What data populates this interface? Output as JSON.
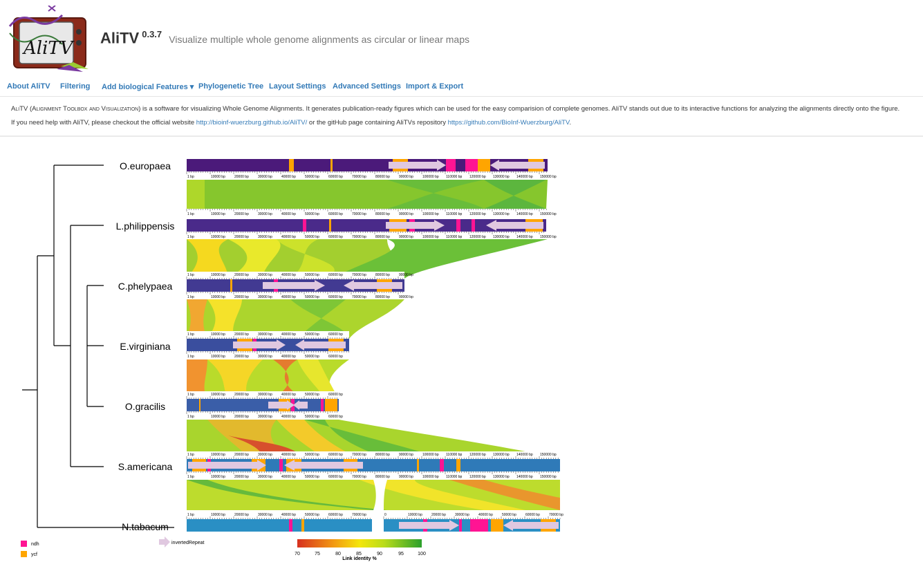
{
  "app": {
    "name": "AliTV",
    "version": "0.3.7",
    "subtitle": "Visualize multiple whole genome alignments as circular or linear maps",
    "logo_text": "AliTV"
  },
  "nav": {
    "items": [
      {
        "label": "About AliTV"
      },
      {
        "label": "Filtering"
      },
      {
        "label": "Add biological Features"
      },
      {
        "label": "Phylogenetic Tree"
      },
      {
        "label": "Layout Settings"
      },
      {
        "label": "Advanced Settings"
      },
      {
        "label": "Import & Export"
      }
    ],
    "dropdown_caret": "▾"
  },
  "info": {
    "name_short": "AliTV",
    "name_long": "(Alignment Toolbox and Visualization)",
    "description": "is a software for visualizing Whole Genome Alignments. It generates publication-ready figures which can be used for the easy comparision of complete genomes. AliTV stands out due to its interactive functions for analyzing the alignments directly onto the figure.",
    "help_prefix": "If you need help with AliTV, please checkout the official website",
    "website": "http://bioinf-wuerzburg.github.io/AliTV/",
    "help_middle": "or the gitHub page containing AliTVs repository",
    "repo": "https://github.com/BioInf-Wuerzburg/AliTV",
    "help_suffix": "."
  },
  "colors": {
    "ndh": "#ff1493",
    "ycf": "#ffa500",
    "inverted_repeat": "#e0c8e0",
    "link_low": "#d7301f",
    "link_high": "#2ca02c"
  },
  "genomes": [
    {
      "name": "O.europaea",
      "color": "#4b1a7a",
      "ticks": [
        "1 bp",
        "10000 bp",
        "20000 bp",
        "30000 bp",
        "40000 bp",
        "50000 bp",
        "60000 bp",
        "70000 bp",
        "80000 bp",
        "90000 bp",
        "100000 bp",
        "110000 bp",
        "120000 bp",
        "130000 bp",
        "140000 bp",
        "150000 bp"
      ]
    },
    {
      "name": "L.philippensis",
      "color": "#4a2a8a",
      "ticks": [
        "1 bp",
        "10000 bp",
        "20000 bp",
        "30000 bp",
        "40000 bp",
        "50000 bp",
        "60000 bp",
        "70000 bp",
        "80000 bp",
        "90000 bp",
        "100000 bp",
        "110000 bp",
        "120000 bp",
        "130000 bp",
        "140000 bp",
        "150000 bp"
      ]
    },
    {
      "name": "C.phelypaea",
      "color": "#423a92",
      "ticks": [
        "1 bp",
        "10000 bp",
        "20000 bp",
        "30000 bp",
        "40000 bp",
        "50000 bp",
        "60000 bp",
        "70000 bp",
        "80000 bp",
        "90000 bp"
      ]
    },
    {
      "name": "E.virginiana",
      "color": "#3a4e9e",
      "ticks": [
        "1 bp",
        "10000 bp",
        "20000 bp",
        "30000 bp",
        "40000 bp",
        "50000 bp",
        "60000 bp",
        "70000 bp"
      ]
    },
    {
      "name": "O.gracilis",
      "color": "#3a5ea8",
      "ticks": [
        "1 bp",
        "10000 bp",
        "20000 bp",
        "30000 bp",
        "40000 bp",
        "50000 bp",
        "60000 bp"
      ]
    },
    {
      "name": "S.americana",
      "color": "#2f7ab8",
      "ticks": [
        "1 bp",
        "10000 bp",
        "20000 bp",
        "30000 bp",
        "40000 bp",
        "50000 bp",
        "60000 bp",
        "70000 bp",
        "80000 bp",
        "90000 bp",
        "100000 bp",
        "110000 bp",
        "120000 bp",
        "130000 bp",
        "140000 bp",
        "150000 bp",
        "16"
      ]
    },
    {
      "name": "N.tabacum",
      "color": "#2a8fc4",
      "ticks_a": [
        "1 bp",
        "10000 bp",
        "20000 bp",
        "30000 bp",
        "40000 bp",
        "50000 bp",
        "60000 bp",
        "70000 bp"
      ],
      "ticks_b": [
        "0",
        "10000 bp",
        "20000 bp",
        "30000 bp",
        "40000 bp",
        "50000 bp",
        "60000 bp",
        "70000 bp"
      ]
    }
  ],
  "legend": {
    "features": [
      {
        "label": "ndh",
        "color": "#ff1493"
      },
      {
        "label": "ycf",
        "color": "#ffa500"
      }
    ],
    "repeat_label": "invertedRepeat",
    "gradient_ticks": [
      "70",
      "75",
      "80",
      "85",
      "90",
      "95",
      "100"
    ],
    "gradient_title": "Link identity %"
  }
}
